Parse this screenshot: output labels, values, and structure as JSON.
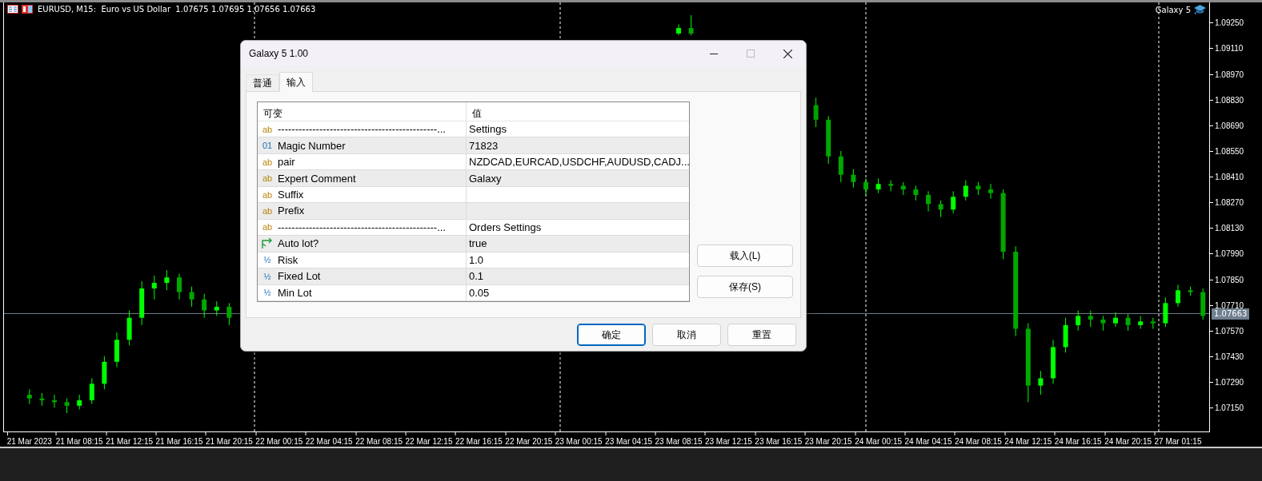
{
  "chart": {
    "symbol_line": "EURUSD, M15:  Euro vs US Dollar  1.07675 1.07695 1.07656 1.07663",
    "expert_label": "Galaxy 5",
    "current_price": "1.07663",
    "chart_data": {
      "type": "candlestick",
      "categories": [
        "21 Mar 2023",
        null,
        null,
        null,
        "21 Mar 08:15",
        null,
        null,
        null,
        "21 Mar 12:15",
        null,
        null,
        null,
        "21 Mar 16:15",
        null,
        null,
        null,
        "21 Mar 20:15",
        null,
        null,
        null,
        "22 Mar 00:15",
        null,
        null,
        null,
        "22 Mar 04:15",
        null,
        null,
        null,
        "22 Mar 08:15",
        null,
        null,
        null,
        "22 Mar 12:15",
        null,
        null,
        null,
        "22 Mar 16:15",
        null,
        null,
        null,
        "22 Mar 20:15",
        null,
        null,
        null,
        "23 Mar 00:15",
        null,
        null,
        null,
        "23 Mar 04:15",
        null,
        null,
        null,
        "23 Mar 08:15",
        null,
        null,
        null,
        "23 Mar 12:15",
        null,
        null,
        null,
        "23 Mar 16:15",
        null,
        null,
        null,
        "23 Mar 20:15",
        null,
        null,
        null,
        "24 Mar 00:15",
        null,
        null,
        null,
        "24 Mar 04:15",
        null,
        null,
        null,
        "24 Mar 08:15",
        null,
        null,
        null,
        "24 Mar 12:15",
        null,
        null,
        null,
        "24 Mar 16:15",
        null,
        null,
        null,
        "24 Mar 20:15",
        null,
        null,
        null,
        "27 Mar 01:15",
        null,
        null
      ],
      "ohlc": [
        [
          1.0722,
          1.0725,
          1.0717,
          1.072
        ],
        [
          1.072,
          1.0723,
          1.0716,
          1.0719
        ],
        [
          1.0719,
          1.0722,
          1.0715,
          1.0718
        ],
        [
          1.0718,
          1.072,
          1.0712,
          1.0716
        ],
        [
          1.0716,
          1.0722,
          1.0714,
          1.0719
        ],
        [
          1.0719,
          1.0731,
          1.0717,
          1.0728
        ],
        [
          1.0728,
          1.0743,
          1.0725,
          1.074
        ],
        [
          1.074,
          1.0756,
          1.0737,
          1.0752
        ],
        [
          1.0752,
          1.0768,
          1.0749,
          1.0764
        ],
        [
          1.0764,
          1.0784,
          1.076,
          1.078
        ],
        [
          1.078,
          1.0787,
          1.0774,
          1.0783
        ],
        [
          1.0783,
          1.079,
          1.0779,
          1.0786
        ],
        [
          1.0786,
          1.0788,
          1.0774,
          1.0778
        ],
        [
          1.0778,
          1.0781,
          1.077,
          1.0774
        ],
        [
          1.0774,
          1.0777,
          1.0764,
          1.0768
        ],
        [
          1.0768,
          1.0773,
          1.0765,
          1.077
        ],
        [
          1.077,
          1.0772,
          1.076,
          1.0764
        ],
        null,
        null,
        null,
        null,
        null,
        null,
        null,
        null,
        null,
        null,
        null,
        null,
        null,
        null,
        null,
        null,
        null,
        null,
        null,
        null,
        null,
        null,
        null,
        null,
        null,
        null,
        null,
        null,
        null,
        null,
        null,
        null,
        null,
        null,
        null,
        [
          1.0919,
          1.0924,
          1.0918,
          1.0922
        ],
        [
          1.0922,
          1.0929,
          1.0918,
          1.0919
        ],
        null,
        null,
        null,
        null,
        null,
        null,
        null,
        null,
        null,
        [
          1.088,
          1.0884,
          1.0868,
          1.0872
        ],
        [
          1.0872,
          1.0874,
          1.0848,
          1.0852
        ],
        [
          1.0852,
          1.0855,
          1.0838,
          1.0842
        ],
        [
          1.0842,
          1.0845,
          1.0835,
          1.0838
        ],
        [
          1.0838,
          1.084,
          1.0831,
          1.0834
        ],
        [
          1.0834,
          1.084,
          1.0832,
          1.0837
        ],
        [
          1.0837,
          1.0839,
          1.0833,
          1.0836
        ],
        [
          1.0836,
          1.0838,
          1.0831,
          1.0834
        ],
        [
          1.0834,
          1.0836,
          1.0828,
          1.0831
        ],
        [
          1.0831,
          1.0833,
          1.0822,
          1.0826
        ],
        [
          1.0826,
          1.0828,
          1.0819,
          1.0823
        ],
        [
          1.0823,
          1.0833,
          1.0821,
          1.083
        ],
        [
          1.083,
          1.0839,
          1.0828,
          1.0836
        ],
        [
          1.0836,
          1.0838,
          1.0831,
          1.0834
        ],
        [
          1.0834,
          1.0837,
          1.0829,
          1.0832
        ],
        [
          1.0832,
          1.0834,
          1.0796,
          1.08
        ],
        [
          1.08,
          1.0803,
          1.0754,
          1.0758
        ],
        [
          1.0758,
          1.0761,
          1.0718,
          1.0727
        ],
        [
          1.0727,
          1.0735,
          1.0722,
          1.0731
        ],
        [
          1.0731,
          1.0752,
          1.0728,
          1.0748
        ],
        [
          1.0748,
          1.0764,
          1.0745,
          1.076
        ],
        [
          1.076,
          1.0768,
          1.0757,
          1.0765
        ],
        [
          1.0765,
          1.0768,
          1.0759,
          1.0763
        ],
        [
          1.0763,
          1.0765,
          1.0757,
          1.0761
        ],
        [
          1.0761,
          1.0767,
          1.0759,
          1.0764
        ],
        [
          1.0764,
          1.0766,
          1.0757,
          1.076
        ],
        [
          1.076,
          1.0765,
          1.0758,
          1.0762
        ],
        [
          1.0762,
          1.0764,
          1.0758,
          1.0761
        ],
        [
          1.0761,
          1.0775,
          1.0759,
          1.0772
        ],
        [
          1.0772,
          1.0782,
          1.077,
          1.0779
        ],
        [
          1.0779,
          1.0781,
          1.0776,
          1.0778
        ],
        [
          1.0778,
          1.078,
          1.0763,
          1.0765
        ]
      ],
      "ylim": [
        1.0702,
        1.0936
      ],
      "yticks": [
        {
          "value": 1.0925,
          "label": "1.09250"
        },
        {
          "value": 1.0911,
          "label": "1.09110"
        },
        {
          "value": 1.0897,
          "label": "1.08970"
        },
        {
          "value": 1.0883,
          "label": "1.08830"
        },
        {
          "value": 1.0869,
          "label": "1.08690"
        },
        {
          "value": 1.0855,
          "label": "1.08550"
        },
        {
          "value": 1.0841,
          "label": "1.08410"
        },
        {
          "value": 1.0827,
          "label": "1.08270"
        },
        {
          "value": 1.0813,
          "label": "1.08130"
        },
        {
          "value": 1.0799,
          "label": "1.07990"
        },
        {
          "value": 1.0785,
          "label": "1.07850"
        },
        {
          "value": 1.0771,
          "label": "1.07710"
        },
        {
          "value": 1.0757,
          "label": "1.07570"
        },
        {
          "value": 1.0743,
          "label": "1.07430"
        },
        {
          "value": 1.0729,
          "label": "1.07290"
        },
        {
          "value": 1.0715,
          "label": "1.07150"
        }
      ],
      "ref_lines": [
        {
          "axis": "y",
          "value": 1.07663
        }
      ]
    }
  },
  "dialog": {
    "title": "Galaxy 5 1.00",
    "tabs": [
      {
        "label": "普通",
        "selected": false
      },
      {
        "label": "输入",
        "selected": true
      }
    ],
    "table": {
      "columns": [
        "可变",
        "值"
      ],
      "rows": [
        {
          "kind": "string",
          "badge": "ab",
          "name": "----------------------------------------------...",
          "value": "Settings"
        },
        {
          "kind": "integer",
          "badge": "01",
          "name": "Magic Number",
          "value": "71823"
        },
        {
          "kind": "string",
          "badge": "ab",
          "name": "pair",
          "value": "NZDCAD,EURCAD,USDCHF,AUDUSD,CADJ..."
        },
        {
          "kind": "string",
          "badge": "ab",
          "name": "Expert Comment",
          "value": "Galaxy"
        },
        {
          "kind": "string",
          "badge": "ab",
          "name": "Suffix"
        },
        {
          "kind": "string",
          "badge": "ab",
          "name": "Prefix"
        },
        {
          "kind": "string",
          "badge": "ab",
          "name": "----------------------------------------------...",
          "value": "Orders Settings"
        },
        {
          "kind": "bool",
          "name": "Auto lot?",
          "value": "true"
        },
        {
          "kind": "double",
          "badge": "½",
          "name": "Risk",
          "value": "1.0"
        },
        {
          "kind": "double",
          "badge": "½",
          "name": "Fixed Lot",
          "value": "0.1"
        },
        {
          "kind": "double",
          "badge": "½",
          "name": "Min Lot",
          "value": "0.05"
        }
      ]
    },
    "side_buttons": [
      "载入(L)",
      "保存(S)"
    ],
    "buttons": [
      {
        "label": "确定",
        "default": true
      },
      {
        "label": "取消",
        "default": false
      },
      {
        "label": "重置",
        "default": false
      }
    ]
  }
}
